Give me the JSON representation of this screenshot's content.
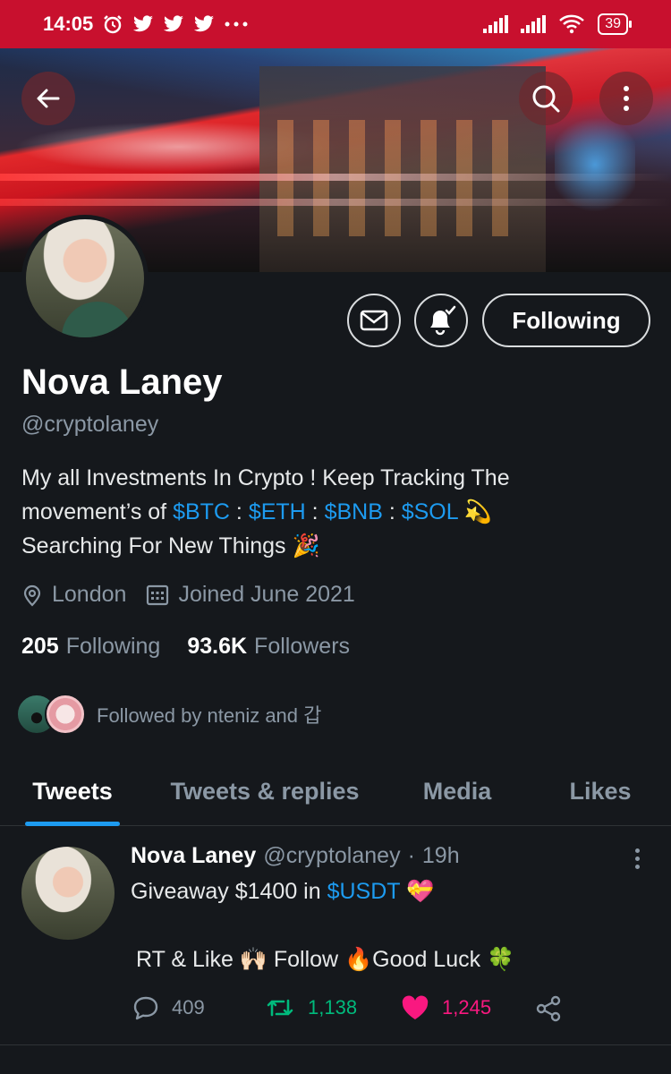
{
  "status_bar": {
    "time": "14:05",
    "battery": "39",
    "icons": [
      "alarm-icon",
      "twitter-icon",
      "twitter-icon",
      "twitter-icon",
      "more-dots-icon",
      "signal-icon",
      "signal-icon",
      "wifi-icon",
      "battery-icon"
    ]
  },
  "header": {
    "back_icon": "back-arrow-icon",
    "search_icon": "search-icon",
    "more_icon": "more-vertical-icon"
  },
  "profile": {
    "name": "Nova Laney",
    "handle": "@cryptolaney",
    "bio": {
      "line1": "My all Investments In Crypto ! Keep Tracking The",
      "line2_prefix": "movement’s of ",
      "btc": "$BTC",
      "sep": " : ",
      "eth": "$ETH",
      "bnb": "$BNB",
      "sol": "$SOL",
      "emoji1": "💫",
      "line3": "Searching For New Things",
      "emoji2": "🎉"
    },
    "location": "London",
    "joined": "Joined June 2021",
    "following_count": "205",
    "following_label": "Following",
    "followers_count": "93.6K",
    "followers_label": "Followers",
    "followed_by": "Followed by nteniz and 갑",
    "follow_button": "Following"
  },
  "tabs": [
    {
      "label": "Tweets",
      "active": true
    },
    {
      "label": "Tweets & replies",
      "active": false
    },
    {
      "label": "Media",
      "active": false
    },
    {
      "label": "Likes",
      "active": false
    }
  ],
  "tweet": {
    "author": "Nova Laney",
    "handle": "@cryptolaney",
    "dot": "·",
    "time": "19h",
    "text1_prefix": "Giveaway $1400 in ",
    "text1_tag": "$USDT",
    "text1_emoji": "💝",
    "text2": "RT & Like 🙌🏻  Follow 🔥Good Luck 🍀",
    "replies": "409",
    "retweets": "1,138",
    "likes": "1,245"
  },
  "colors": {
    "status_bar": "#c8102e",
    "background": "#15181c",
    "accent": "#1d9bf0",
    "retweet": "#00ba7c",
    "like": "#f91880",
    "muted": "#8b98a5"
  }
}
